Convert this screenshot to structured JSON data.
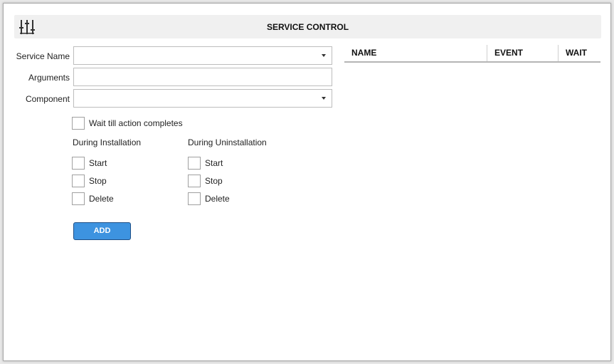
{
  "header": {
    "title": "SERVICE CONTROL",
    "icon": "sliders-icon"
  },
  "form": {
    "service_name_label": "Service Name",
    "service_name_value": "",
    "arguments_label": "Arguments",
    "arguments_value": "",
    "component_label": "Component",
    "component_value": "",
    "wait_label": "Wait till action completes",
    "wait_checked": false
  },
  "installation": {
    "title": "During Installation",
    "options": [
      {
        "label": "Start",
        "checked": false
      },
      {
        "label": "Stop",
        "checked": false
      },
      {
        "label": "Delete",
        "checked": false
      }
    ]
  },
  "uninstallation": {
    "title": "During Uninstallation",
    "options": [
      {
        "label": "Start",
        "checked": false
      },
      {
        "label": "Stop",
        "checked": false
      },
      {
        "label": "Delete",
        "checked": false
      }
    ]
  },
  "add_button": {
    "label": "ADD",
    "color": "#3d93e0"
  },
  "grid": {
    "columns": [
      "NAME",
      "EVENT",
      "WAIT"
    ],
    "rows": []
  }
}
